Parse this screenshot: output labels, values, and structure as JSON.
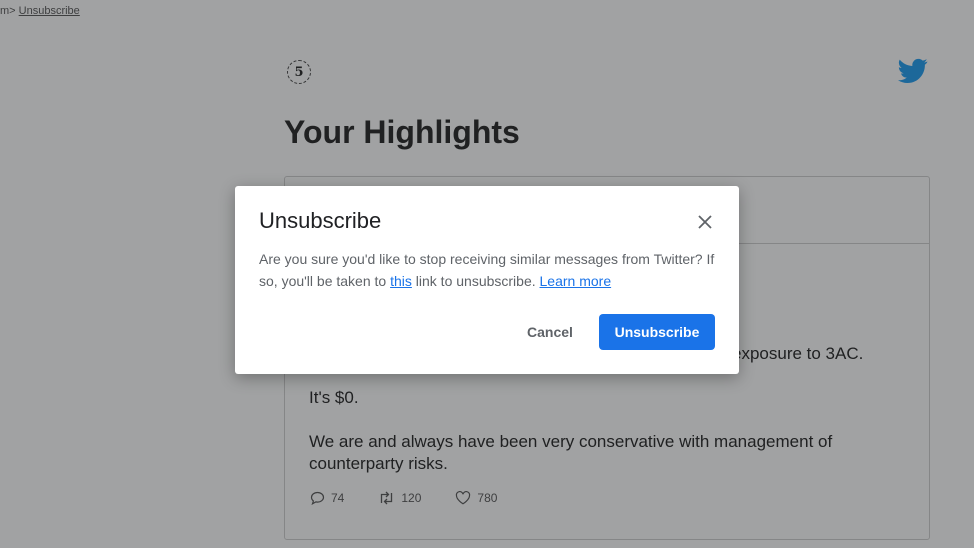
{
  "topbar": {
    "prefix": "m>",
    "unsubscribe_link": "Unsubscribe"
  },
  "email": {
    "logo_text": "5",
    "title": "Your Highlights",
    "tweet": {
      "line1_partial": "exposure to 3AC.",
      "line2": "It's $0.",
      "line3": "We are and always have been very conservative with management of counterparty risks.",
      "replies": "74",
      "retweets": "120",
      "likes": "780"
    },
    "brand_color": "#1d9bf0"
  },
  "dialog": {
    "title": "Unsubscribe",
    "body_part1": "Are you sure you'd like to stop receiving similar messages from Twitter? If so, you'll be taken to ",
    "body_link": "this",
    "body_part2": " link to unsubscribe. ",
    "learn_more": "Learn more",
    "cancel_label": "Cancel",
    "confirm_label": "Unsubscribe",
    "accent_color": "#1a73e8",
    "close_icon": "close-icon"
  }
}
